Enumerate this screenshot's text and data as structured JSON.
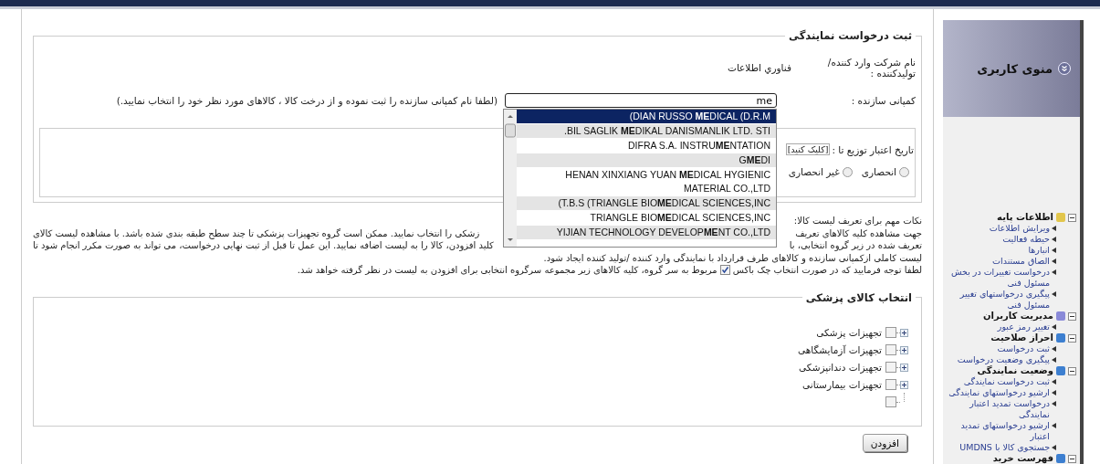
{
  "sidebar": {
    "title": "منوی کاربری",
    "groups": [
      {
        "title": "اطلاعات پایه",
        "color": "#e2c64c",
        "expanded": true,
        "items": [
          "ویرایش اطلاعات",
          "حیطه فعالیت",
          "انبارها",
          "الصاق مستندات",
          "درخواست تغییرات در بخش مسئول فنی",
          "پیگیری درخواستهای تغییر مسئول فنی"
        ]
      },
      {
        "title": "مدیریت کاربران",
        "color": "#8a8ad8",
        "expanded": true,
        "items": [
          "تغییر رمز عبور"
        ]
      },
      {
        "title": "احراز صلاحیت",
        "color": "#3d7fd0",
        "expanded": true,
        "items": [
          "ثبت درخواست",
          "پیگیری وضعیت درخواست"
        ]
      },
      {
        "title": "وضعیت نمایندگی",
        "color": "#3d7fd0",
        "expanded": true,
        "items": [
          "ثبت درخواست نمایندگی",
          "ارشیو درخواستهای نمایندگی",
          "درخواست تمدید اعتبار نمایندگی",
          "ارشیو درخواستهای تمدید اعتبار",
          "جستجوی کالا با UMDNS"
        ]
      },
      {
        "title": "فهرست خرید",
        "color": "#3d7fd0",
        "expanded": true
      }
    ]
  },
  "form": {
    "title": "ثبت درخواست نمایندگی",
    "company_label": "نام شرکت وارد کننده/تولیدکننده :",
    "company_value": "فناوري اطلاعات",
    "maker_label": "کمپانی سازنده :",
    "maker_value": "me",
    "maker_hint": "(لطفا نام کمپانی سازنده را ثبت نموده و از درخت کالا ، کالاهای مورد نظر خود را انتخاب نمایید.)",
    "suggestions": [
      {
        "text": "(DIAN RUSSO **ME**DICAL (D.R.M",
        "selected": true
      },
      {
        "text": ".BIL SAGLIK **ME**DIKAL DANISMANLIK LTD. STI",
        "selected": false
      },
      {
        "text": "DIFRA S.A. INSTRU**ME**NTATION",
        "selected": false
      },
      {
        "text": "G**ME**DI",
        "selected": false
      },
      {
        "text": "HENAN XINXIANG YUAN **ME**DICAL HYGIENIC MATERIAL CO.,LTD",
        "selected": false
      },
      {
        "text": "(T.B.S (TRIANGLE BIO**ME**DICAL SCIENCES,INC",
        "selected": false
      },
      {
        "text": "TRIANGLE BIO**ME**DICAL SCIENCES,INC",
        "selected": false
      },
      {
        "text": "YIJIAN TECHNOLOGY DEVELOP**ME**NT CO.,LTD",
        "selected": false
      }
    ],
    "date_label": "تاریخ اعتبار توزیع تا :",
    "date_value": "[کلیک کنید]",
    "options": [
      {
        "label": "انحصاری",
        "selected": false
      },
      {
        "label": "غیر انحصاری",
        "selected": false
      }
    ]
  },
  "notes": {
    "title": "نکات مهم برای تعریف لیست کالا:",
    "split_lines": [
      {
        "right": "جهت مشاهده کلیه کالاهای تعریف",
        "left": "زشکی را انتخاب نمایید. ممکن است گروه تجهیزات پزشکی تا چند سطح طبقه بندی شده باشد. با مشاهده لیست کالای"
      },
      {
        "right": "تعریف شده در زیر گروه انتخابی، با",
        "left": "کلید افزودن، کالا را به لیست اضافه نمایید. این عمل تا قبل از ثبت نهایی درخواست، می تواند به صورت مکرر انجام شود تا"
      }
    ],
    "line": "لیست کاملی ازکمپانی سازنده و کالاهای طرف قرارداد با نمایندگی وارد کننده /تولید کننده ایجاد شود.",
    "last": {
      "before": "لطفا توجه فرمایید که در صورت انتخاب چک باکس",
      "checked": true,
      "after": "مربوط به سر گروه، کلیه کالاهای زیر مجموعه سرگروه انتخابی برای افزودن به لیست در نظر گرفته خواهد شد."
    }
  },
  "tree": {
    "title": "انتخاب کالای پزشکی",
    "items": [
      {
        "kind": "group",
        "label": "تجهیزات پزشکی",
        "expanded": false,
        "checked": false
      },
      {
        "kind": "group",
        "label": "تجهیزات آزمایشگاهی",
        "expanded": false,
        "checked": false
      },
      {
        "kind": "group",
        "label": "تجهیزات دندانپزشکی",
        "expanded": false,
        "checked": false
      },
      {
        "kind": "group",
        "label": "تجهیزات بیمارستانی",
        "expanded": false,
        "checked": false
      },
      {
        "kind": "blank",
        "checked": false
      }
    ]
  },
  "add_button": "افزودن"
}
